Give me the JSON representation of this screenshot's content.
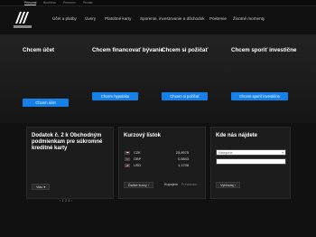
{
  "topbar": {
    "segments": [
      "Personal",
      "Business",
      "Premium",
      "Private"
    ]
  },
  "nav": {
    "items": [
      "Účet a platby",
      "Úvery",
      "Platobné karty",
      "Sporenie, investovanie a dôchodok",
      "Poistenie",
      "Životné momenty"
    ]
  },
  "hero": {
    "columns": [
      {
        "title": "Chcem účet",
        "text": "",
        "button": "Chcem účet"
      },
      {
        "title": "Chcem financovať bývanie",
        "text": "",
        "button": "Chcem hypotéku"
      },
      {
        "title": "Chcem si požičať",
        "text": "",
        "button": "Chcem si požičať"
      },
      {
        "title": "Chcem sporiť investične",
        "text": "",
        "button": "Chcem sporiť investične"
      }
    ]
  },
  "panels": {
    "promo": {
      "title": "Dodatok č. 2 k Obchodným podmienkam pre súkromné kreditné karty",
      "text": "",
      "more": "Viac",
      "pager": "1 2 3"
    },
    "rates": {
      "title": "Kurzový lístok",
      "rows": [
        {
          "code": "CZK",
          "value": "25,8975",
          "flag": "cz"
        },
        {
          "code": "GBP",
          "value": "0,8843",
          "flag": "gb"
        },
        {
          "code": "USD",
          "value": "1,1708",
          "flag": "us"
        }
      ],
      "more": "Ďalšie kurzy",
      "tab1": "Kupujem",
      "tab2": "Predávam"
    },
    "find": {
      "title": "Kde nás nájdete",
      "select_placeholder": "Kategória",
      "input_placeholder": "",
      "button": "Vyhľadaj"
    }
  }
}
